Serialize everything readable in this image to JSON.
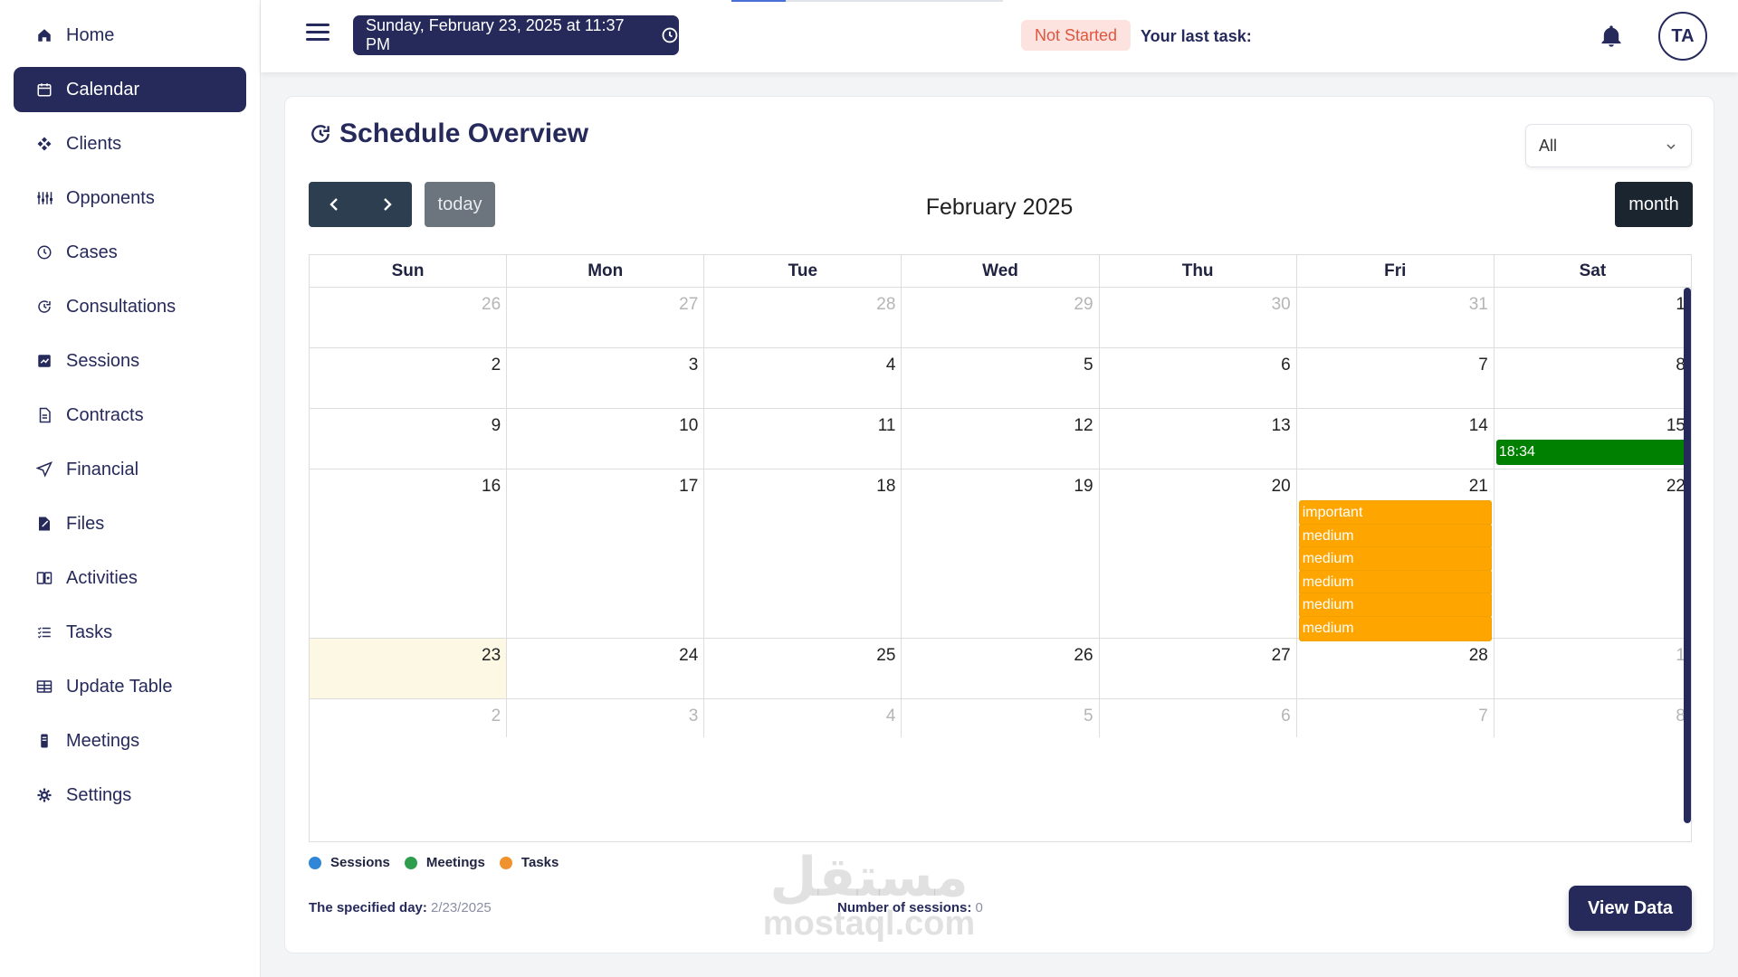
{
  "sidebar": {
    "items": [
      {
        "label": "Home",
        "icon": "home-icon",
        "active": false
      },
      {
        "label": "Calendar",
        "icon": "calendar-icon",
        "active": true
      },
      {
        "label": "Clients",
        "icon": "clients-icon",
        "active": false
      },
      {
        "label": "Opponents",
        "icon": "opponents-icon",
        "active": false
      },
      {
        "label": "Cases",
        "icon": "cases-icon",
        "active": false
      },
      {
        "label": "Consultations",
        "icon": "consultations-icon",
        "active": false
      },
      {
        "label": "Sessions",
        "icon": "sessions-icon",
        "active": false
      },
      {
        "label": "Contracts",
        "icon": "contracts-icon",
        "active": false
      },
      {
        "label": "Financial",
        "icon": "financial-icon",
        "active": false
      },
      {
        "label": "Files",
        "icon": "files-icon",
        "active": false
      },
      {
        "label": "Activities",
        "icon": "activities-icon",
        "active": false
      },
      {
        "label": "Tasks",
        "icon": "tasks-icon",
        "active": false
      },
      {
        "label": "Update Table",
        "icon": "table-icon",
        "active": false
      },
      {
        "label": "Meetings",
        "icon": "meetings-icon",
        "active": false
      },
      {
        "label": "Settings",
        "icon": "gear-icon",
        "active": false
      }
    ]
  },
  "topbar": {
    "datetime": "Sunday, February 23, 2025 at 11:37 PM",
    "status": "Not Started",
    "last_task_label": "Your last task:",
    "avatar_initials": "TA"
  },
  "overview": {
    "title": "Schedule Overview",
    "filter_value": "All",
    "today_label": "today",
    "month_title": "February 2025",
    "view_label": "month",
    "weekdays": [
      "Sun",
      "Mon",
      "Tue",
      "Wed",
      "Thu",
      "Fri",
      "Sat"
    ],
    "weeks": [
      [
        {
          "d": "26",
          "o": true
        },
        {
          "d": "27",
          "o": true
        },
        {
          "d": "28",
          "o": true
        },
        {
          "d": "29",
          "o": true
        },
        {
          "d": "30",
          "o": true
        },
        {
          "d": "31",
          "o": true
        },
        {
          "d": "1",
          "o": false
        }
      ],
      [
        {
          "d": "2",
          "o": false
        },
        {
          "d": "3",
          "o": false
        },
        {
          "d": "4",
          "o": false
        },
        {
          "d": "5",
          "o": false
        },
        {
          "d": "6",
          "o": false
        },
        {
          "d": "7",
          "o": false
        },
        {
          "d": "8",
          "o": false
        }
      ],
      [
        {
          "d": "9",
          "o": false
        },
        {
          "d": "10",
          "o": false
        },
        {
          "d": "11",
          "o": false
        },
        {
          "d": "12",
          "o": false
        },
        {
          "d": "13",
          "o": false
        },
        {
          "d": "14",
          "o": false
        },
        {
          "d": "15",
          "o": false,
          "events": [
            {
              "label": "18:34",
              "color": "#008000"
            }
          ]
        }
      ],
      [
        {
          "d": "16",
          "o": false
        },
        {
          "d": "17",
          "o": false
        },
        {
          "d": "18",
          "o": false
        },
        {
          "d": "19",
          "o": false
        },
        {
          "d": "20",
          "o": false
        },
        {
          "d": "21",
          "o": false,
          "events": [
            {
              "label": "important",
              "color": "#ffa500"
            },
            {
              "label": "medium",
              "color": "#ffa500"
            },
            {
              "label": "medium",
              "color": "#ffa500"
            },
            {
              "label": "medium",
              "color": "#ffa500"
            },
            {
              "label": "medium",
              "color": "#ffa500"
            },
            {
              "label": "medium",
              "color": "#ffa500"
            }
          ]
        },
        {
          "d": "22",
          "o": false
        }
      ],
      [
        {
          "d": "23",
          "o": false,
          "today": true
        },
        {
          "d": "24",
          "o": false
        },
        {
          "d": "25",
          "o": false
        },
        {
          "d": "26",
          "o": false
        },
        {
          "d": "27",
          "o": false
        },
        {
          "d": "28",
          "o": false
        },
        {
          "d": "1",
          "o": true
        }
      ],
      [
        {
          "d": "2",
          "o": true
        },
        {
          "d": "3",
          "o": true
        },
        {
          "d": "4",
          "o": true
        },
        {
          "d": "5",
          "o": true
        },
        {
          "d": "6",
          "o": true
        },
        {
          "d": "7",
          "o": true
        },
        {
          "d": "8",
          "o": true
        }
      ]
    ],
    "legend": [
      {
        "label": "Sessions",
        "color": "#2f86d6"
      },
      {
        "label": "Meetings",
        "color": "#2e9e4e"
      },
      {
        "label": "Tasks",
        "color": "#f0922e"
      }
    ],
    "specified_day_label": "The specified day:",
    "specified_day_value": "2/23/2025",
    "sessions_label": "Number of sessions:",
    "sessions_value": "0",
    "view_data_label": "View Data"
  },
  "watermark": {
    "arabic": "مستقل",
    "latin": "mostaql.com"
  },
  "colors": {
    "primary": "#262a5b",
    "accent_status_bg": "#fde3e0",
    "accent_status_text": "#e0553d",
    "today_bg": "#fcf8e3"
  }
}
